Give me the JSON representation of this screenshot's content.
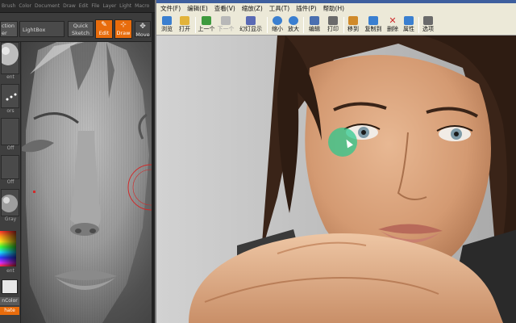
{
  "zbrush": {
    "menu": [
      "Brush",
      "Color",
      "Document",
      "Draw",
      "Edit",
      "File",
      "Layer",
      "Light",
      "Macro"
    ],
    "toolbar": {
      "projection_label": "ction",
      "projection_sub": "er",
      "lightbox_label": "LightBox",
      "quick_sketch_line1": "Quick",
      "quick_sketch_line2": "Sketch",
      "edit_label": "Edit",
      "draw_label": "Draw",
      "move_label": "Move"
    },
    "left_panel": {
      "labels": [
        "ent",
        "ors",
        "Off",
        "Off",
        "Gray",
        "ent"
      ],
      "color_label": "nColor",
      "orange_label": "hate"
    },
    "colors": {
      "accent": "#e86c0c",
      "panel": "#3a3a3a"
    }
  },
  "viewer": {
    "menu": [
      "文件(F)",
      "编辑(E)",
      "查看(V)",
      "缩放(Z)",
      "工具(T)",
      "插件(P)",
      "帮助(H)"
    ],
    "toolbar": [
      {
        "label": "浏览",
        "icon": "browse-icon",
        "color": "#3a7fd0"
      },
      {
        "label": "打开",
        "icon": "open-folder-icon",
        "color": "#e2b33a"
      },
      {
        "label": "上一个",
        "icon": "previous-icon",
        "color": "#3e9a3e"
      },
      {
        "label": "下一个",
        "icon": "next-icon",
        "color": "#9a9a9a",
        "disabled": true
      },
      {
        "label": "幻灯显示",
        "icon": "slideshow-icon",
        "color": "#5a6ab5"
      },
      {
        "label": "缩小",
        "icon": "zoom-out-icon",
        "color": "#3a7fd0"
      },
      {
        "label": "放大",
        "icon": "zoom-in-icon",
        "color": "#3a7fd0"
      },
      {
        "label": "编辑",
        "icon": "edit-icon",
        "color": "#4a6fb0"
      },
      {
        "label": "打印",
        "icon": "print-icon",
        "color": "#6a6a6a"
      },
      {
        "label": "移到",
        "icon": "move-to-icon",
        "color": "#d08a2a"
      },
      {
        "label": "复制到",
        "icon": "copy-to-icon",
        "color": "#3a7fd0"
      },
      {
        "label": "删除",
        "icon": "delete-icon",
        "color": "#d02a2a"
      },
      {
        "label": "属性",
        "icon": "properties-icon",
        "color": "#3a7fd0"
      },
      {
        "label": "选项",
        "icon": "options-icon",
        "color": "#6a6a6a"
      }
    ],
    "colors": {
      "chrome": "#ece9d8",
      "title": "#3e5f9e",
      "highlight": "#28c88c"
    }
  }
}
